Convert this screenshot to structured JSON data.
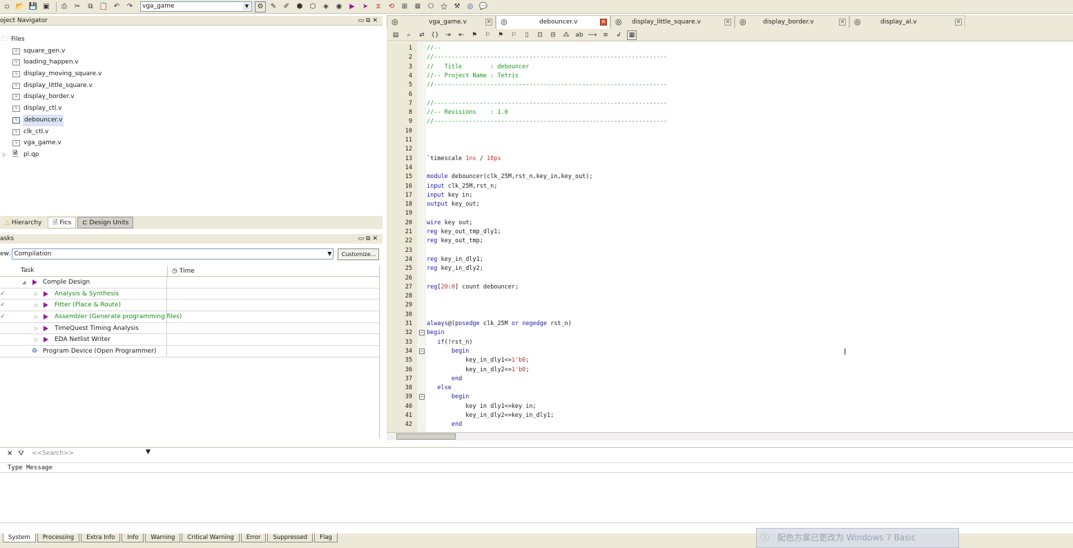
{
  "toolbar": {
    "project_select": "vga_game",
    "icons": [
      "open-icon",
      "save-icon",
      "save-all-icon",
      "print-icon",
      "cut-icon",
      "copy-icon",
      "paste-icon",
      "undo-icon",
      "redo-icon"
    ]
  },
  "project_navigator": {
    "title": "oject Navigator",
    "folder": "Files",
    "files": [
      "square_gen.v",
      "loading_happen.v",
      "display_moving_square.v",
      "display_little_square.v",
      "display_border.v",
      "display_ctl.v",
      "debouncer.v",
      "clk_ctl.v",
      "vga_game.v"
    ],
    "extra_file": "pl.qp",
    "selected_file": "debouncer.v"
  },
  "nav_tabs": {
    "hierarchy": "Hierarchy",
    "files": "Fics",
    "design_units": "Design Units"
  },
  "tasks": {
    "title": "asks",
    "flow_label": "ew:",
    "flow_value": "Compilation",
    "customize_label": "Customize...",
    "col_task": "Task",
    "col_time": "Time",
    "rows": [
      {
        "label": "Comple Design",
        "status": ""
      },
      {
        "label": "Analysis & Synthesis",
        "status": "✓"
      },
      {
        "label": "Fitter (Place & Route)",
        "status": "✓"
      },
      {
        "label": "Assembler (Generate programming files)",
        "status": "✓"
      },
      {
        "label": "TimeQuest Timing Analysis",
        "status": ""
      },
      {
        "label": "EDA Netlist Writer",
        "status": ""
      },
      {
        "label": "Program Device (Open Programmer)",
        "status": ""
      }
    ]
  },
  "editor_tabs": [
    {
      "label": "vga_game.v",
      "active": false
    },
    {
      "label": "debouncer.v",
      "active": true
    },
    {
      "label": "display_little_square.v",
      "active": false
    },
    {
      "label": "display_border.v",
      "active": false
    },
    {
      "label": "display_al.v",
      "active": false
    }
  ],
  "code_lines": [
    {
      "n": "1",
      "text": "//--"
    },
    {
      "n": "2",
      "text": "//------------------------------------------------------------------"
    },
    {
      "n": "3",
      "text": "//   Title        : debouncer"
    },
    {
      "n": "4",
      "text": "//-- Project Name : Tetris"
    },
    {
      "n": "5",
      "text": "//------------------------------------------------------------------"
    },
    {
      "n": "6",
      "text": ""
    },
    {
      "n": "7",
      "text": "//------------------------------------------------------------------"
    },
    {
      "n": "8",
      "text": "//-- Revisions    : 1.0"
    },
    {
      "n": "9",
      "text": "//------------------------------------------------------------------"
    },
    {
      "n": "10",
      "text": ""
    },
    {
      "n": "11",
      "text": ""
    },
    {
      "n": "12",
      "text": ""
    },
    {
      "n": "13",
      "text": "`timescale 1ns / 10ps"
    },
    {
      "n": "14",
      "text": ""
    },
    {
      "n": "15",
      "text": "module debouncer(clk_25M,rst_n,key_in,key_out);"
    },
    {
      "n": "16",
      "text": "input clk_25M,rst_n;"
    },
    {
      "n": "17",
      "text": "input key in;"
    },
    {
      "n": "18",
      "text": "output key_out;"
    },
    {
      "n": "19",
      "text": ""
    },
    {
      "n": "20",
      "text": "wire key out;"
    },
    {
      "n": "21",
      "text": "reg key_out_tmp_dly1;"
    },
    {
      "n": "22",
      "text": "reg key_out_tmp;"
    },
    {
      "n": "23",
      "text": ""
    },
    {
      "n": "24",
      "text": "reg key_in_dly1;"
    },
    {
      "n": "25",
      "text": "reg key_in_dly2;"
    },
    {
      "n": "26",
      "text": ""
    },
    {
      "n": "27",
      "text": "reg[20:0] count debouncer;"
    },
    {
      "n": "28",
      "text": ""
    },
    {
      "n": "29",
      "text": ""
    },
    {
      "n": "30",
      "text": ""
    },
    {
      "n": "31",
      "text": "always@(posedge clk_25M or negedge rst_n)"
    },
    {
      "n": "32",
      "text": "begin"
    },
    {
      "n": "33",
      "text": "   if(!rst_n)"
    },
    {
      "n": "34",
      "text": "       begin"
    },
    {
      "n": "35",
      "text": "           key_in_dly1<=1'b0;"
    },
    {
      "n": "36",
      "text": "           key_in_dly2<=1'b0;"
    },
    {
      "n": "37",
      "text": "       end"
    },
    {
      "n": "38",
      "text": "   else"
    },
    {
      "n": "39",
      "text": "       begin"
    },
    {
      "n": "40",
      "text": "           key in dly1<=key in;"
    },
    {
      "n": "41",
      "text": "           key_in_dly2<=key_in_dly1;"
    },
    {
      "n": "42",
      "text": "       end"
    }
  ],
  "messages": {
    "search_placeholder": "<<Search>>",
    "header": "Type Message",
    "tabs": [
      "System",
      "Processing",
      "Extra Info",
      "Info",
      "Warning",
      "Critical Warning",
      "Error",
      "Suppressed",
      "Flag"
    ],
    "active_tab": "System"
  },
  "watermark": "配色方案已更改为 Windows 7 Basic",
  "colors": {
    "comment": "#1a9a1a",
    "keyword": "#1a1aa0",
    "number": "#c03030",
    "accent_tab_close": "#e0502a"
  }
}
